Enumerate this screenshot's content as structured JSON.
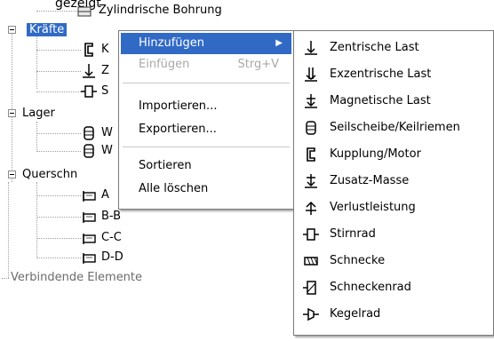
{
  "caption": "Zylindrische Bohrung",
  "caption_top": "gezeigt",
  "tree": {
    "kraefte": "Kräfte",
    "kraefte_children": [
      "K",
      "Z",
      "S"
    ],
    "lager": "Lager",
    "lager_children": [
      "W",
      "W"
    ],
    "querschnitte": "Querschn",
    "querschnitte_children": [
      "A",
      "B-B",
      "C-C",
      "D-D"
    ],
    "verbindende": "Verbindende Elemente"
  },
  "context_menu": {
    "items": [
      {
        "label": "Hinzufügen",
        "has_submenu": true
      },
      {
        "label": "Einfügen",
        "shortcut": "Strg+V",
        "disabled": true
      },
      {
        "label": "Importieren..."
      },
      {
        "label": "Exportieren..."
      },
      {
        "label": "Sortieren"
      },
      {
        "label": "Alle löschen"
      }
    ]
  },
  "submenu": {
    "items": [
      {
        "label": "Zentrische Last",
        "icon": "centric-load-icon"
      },
      {
        "label": "Exzentrische Last",
        "icon": "eccentric-load-icon"
      },
      {
        "label": "Magnetische Last",
        "icon": "magnetic-load-icon"
      },
      {
        "label": "Seilscheibe/Keilriemen",
        "icon": "pulley-icon"
      },
      {
        "label": "Kupplung/Motor",
        "icon": "coupling-icon"
      },
      {
        "label": "Zusatz-Masse",
        "icon": "additional-mass-icon"
      },
      {
        "label": "Verlustleistung",
        "icon": "power-loss-icon"
      },
      {
        "label": "Stirnrad",
        "icon": "spur-gear-icon"
      },
      {
        "label": "Schnecke",
        "icon": "worm-icon"
      },
      {
        "label": "Schneckenrad",
        "icon": "worm-wheel-icon"
      },
      {
        "label": "Kegelrad",
        "icon": "bevel-gear-icon"
      }
    ]
  },
  "colors": {
    "selection": "#316ac5",
    "disabled_text": "#a8a8a8",
    "tree_lines": "#a0a0a0"
  }
}
